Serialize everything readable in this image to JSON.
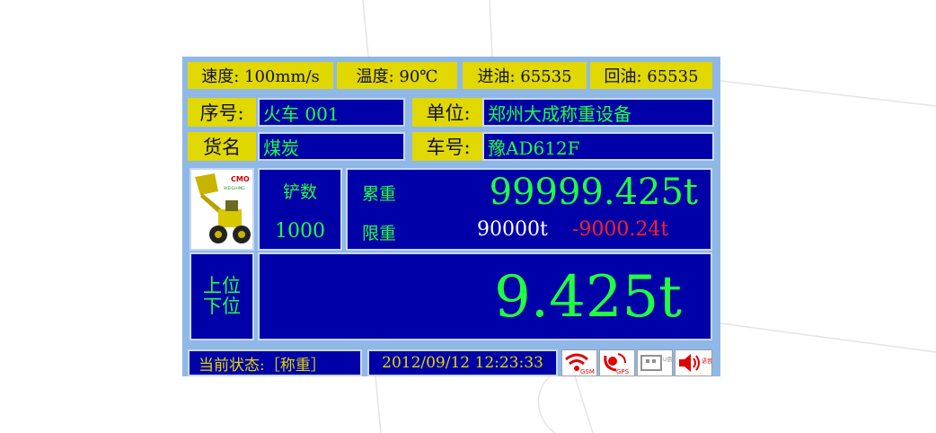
{
  "top": {
    "speed": "速度: 100mm/s",
    "temp": "温度: 90℃",
    "oil_in": "进油: 65535",
    "oil_back": "回油: 65535"
  },
  "info": {
    "serial_label": "序号:",
    "serial_value": "火车 001",
    "unit_label": "单位:",
    "unit_value": "郑州大成称重设备",
    "cargo_label": "货名",
    "cargo_value": "煤炭",
    "plate_label": "车号:",
    "plate_value": "豫AD612F"
  },
  "logo": {
    "line1": "CMO",
    "line2": "WEIGHING"
  },
  "counts": {
    "shovel_label": "铲数",
    "shovel_value": "1000",
    "total_label": "累重",
    "total_value": "99999.425t",
    "limit_label": "限重",
    "limit_value": "90000t",
    "limit_diff": "-9000.24t"
  },
  "weight": {
    "pos_upper": "上位",
    "pos_lower": "下位",
    "current": "9.425t"
  },
  "status_bar": {
    "state": "当前状态:［称重］",
    "datetime": "2012/09/12 12:23:33",
    "gsm": "GSM",
    "gps": "GPS",
    "usb": "U盘",
    "voice": "语音"
  },
  "colors": {
    "panel_bg": "#8fb8e6",
    "box_navy": "#0000a8",
    "label_yellow": "#e0d800",
    "value_green": "#20ff40",
    "alert_red": "#ff2020"
  },
  "icons": [
    "wifi-icon",
    "satellite-icon",
    "usb-drive-icon",
    "speaker-icon"
  ]
}
